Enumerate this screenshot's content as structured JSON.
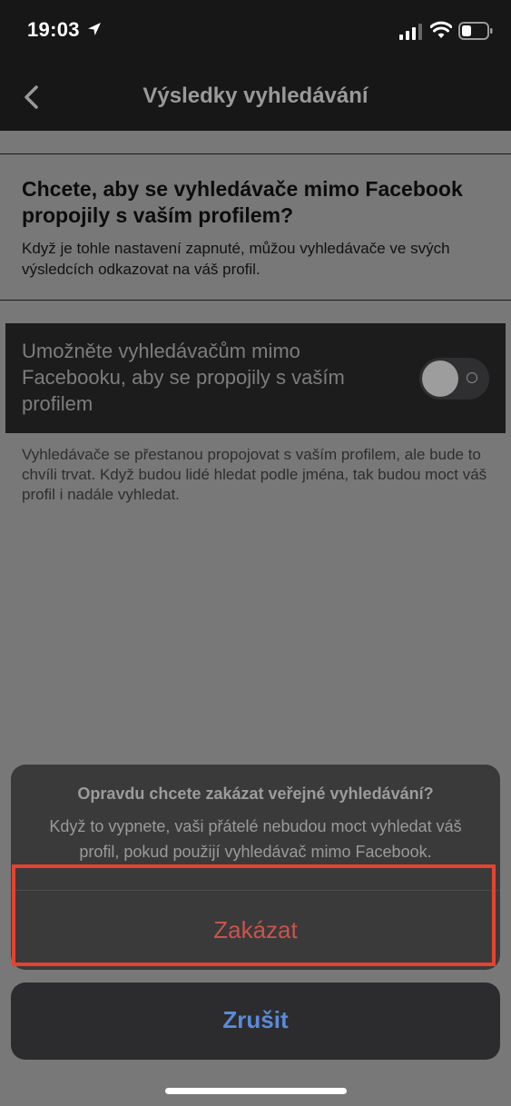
{
  "status_bar": {
    "time": "19:03",
    "icons": [
      "location-arrow-icon",
      "cellular-signal-icon",
      "wifi-icon",
      "battery-icon"
    ]
  },
  "nav": {
    "title": "Výsledky vyhledávání",
    "back_icon": "chevron-left-icon"
  },
  "content": {
    "heading": "Chcete, aby se vyhledávače mimo Facebook propojily s vaším profilem?",
    "description": "Když je tohle nastavení zapnuté, můžou vyhledávače ve svých výsledcích odkazovat na váš profil.",
    "toggle": {
      "label": "Umožněte vyhledávačům mimo Facebooku, aby se propojily s vaším profilem",
      "state": "off"
    },
    "footnote": "Vyhledávače se přestanou propojovat s vaším profilem, ale bude to chvíli trvat. Když budou lidé hledat podle jména, tak budou moct váš profil i nadále vyhledat."
  },
  "action_sheet": {
    "title": "Opravdu chcete zakázat veřejné vyhledávání?",
    "message": "Když to vypnete, vaši přátelé nebudou moct vyhledat váš profil, pokud použijí vyhledávač mimo Facebook.",
    "destructive_label": "Zakázat",
    "cancel_label": "Zrušit"
  },
  "colors": {
    "destructive": "#c9544c",
    "cancel": "#5b8ad8",
    "highlight": "#e5432f"
  }
}
